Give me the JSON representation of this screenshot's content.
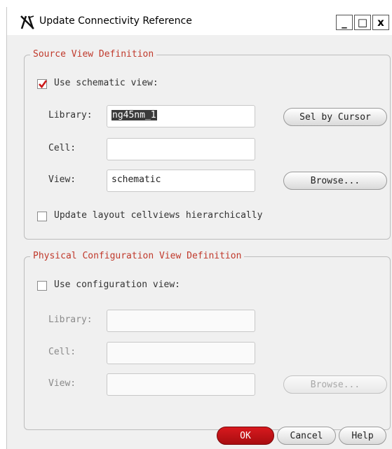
{
  "window": {
    "title": "Update Connectivity Reference"
  },
  "titlebar_buttons": {
    "minimize": "_",
    "maximize": "□",
    "close": "x"
  },
  "source_group": {
    "legend": "Source View Definition",
    "use_schematic": {
      "label": "Use schematic view:",
      "checked": true
    },
    "library": {
      "label": "Library:",
      "value": "ng45nm_1"
    },
    "cell": {
      "label": "Cell:",
      "value": ""
    },
    "view": {
      "label": "View:",
      "value": "schematic"
    },
    "sel_by_cursor": "Sel by Cursor",
    "browse": "Browse...",
    "hierarchical": {
      "label": "Update layout cellviews hierarchically",
      "checked": false
    }
  },
  "physical_group": {
    "legend": "Physical Configuration View Definition",
    "use_config": {
      "label": "Use configuration view:",
      "checked": false
    },
    "library": {
      "label": "Library:",
      "value": ""
    },
    "cell": {
      "label": "Cell:",
      "value": ""
    },
    "view": {
      "label": "View:",
      "value": ""
    },
    "browse": "Browse..."
  },
  "footer": {
    "ok": "OK",
    "cancel": "Cancel",
    "help": "Help"
  },
  "colors": {
    "legend": "#c0392b",
    "ok_button": "#c41519",
    "check_mark": "#cc1a1a"
  }
}
